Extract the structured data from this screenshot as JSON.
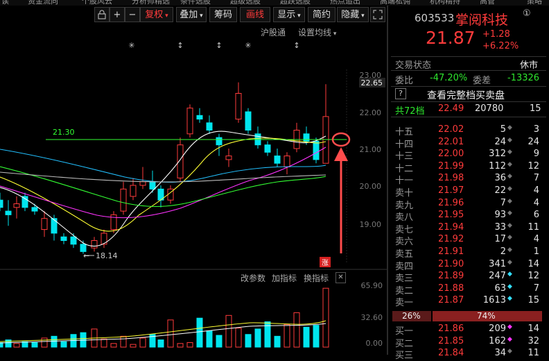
{
  "top_nav": [
    "读",
    "资金流向",
    "个股风云",
    "分析师精选",
    "条件选股",
    "超级选股",
    "超跌选股",
    "热点追出",
    "高端私佣",
    "机构精持",
    "高管",
    "策略"
  ],
  "toolbar": {
    "fuquan": "复权",
    "diejia": "叠加",
    "chouma": "筹码",
    "huaxian": "画线",
    "xianshi": "显示",
    "jianyue": "简约",
    "yincang": "隐藏",
    "plus": "+",
    "minus": "−",
    "fullscreen_icon": "expand-icon",
    "lock_icon": "lock-icon"
  },
  "chart_header": {
    "exchange": "沪股通",
    "ma_setting": "设置均线"
  },
  "indicator_header": {
    "change_params": "改参数",
    "add_indicator": "加指标",
    "switch_indicator": "换指标",
    "close": "✕"
  },
  "price_axis": [
    "23.00",
    "22.00",
    "21.00",
    "20.00",
    "19.00"
  ],
  "current_price_tag": "22.65",
  "hline_label": "21.30",
  "low_label": "18.14",
  "zhang_badge": "涨",
  "volume_axis": [
    "65.90",
    "32.60",
    "0.00"
  ],
  "stock": {
    "code": "603533",
    "name": "掌阅科技",
    "price": "21.87",
    "change": "+1.28",
    "change_pct": "+6.22%",
    "badge": "①"
  },
  "status": {
    "label": "交易状态",
    "value": "休市"
  },
  "weibi": {
    "label": "委比",
    "value": "-47.20%",
    "label2": "委差",
    "value2": "-13326"
  },
  "full_book": {
    "q": "?",
    "text": "查看完整档买卖盘"
  },
  "total_levels": {
    "label": "共72档",
    "price": "22.49",
    "vol": "20780",
    "count": "15"
  },
  "asks": [
    {
      "label": "十五",
      "price": "22.02",
      "vol": "5",
      "count": "3"
    },
    {
      "label": "十四",
      "price": "22.01",
      "vol": "24",
      "count": "24"
    },
    {
      "label": "十三",
      "price": "22.00",
      "vol": "312",
      "count": "9"
    },
    {
      "label": "十二",
      "price": "21.99",
      "vol": "112",
      "count": "12"
    },
    {
      "label": "十一",
      "price": "21.98",
      "vol": "36",
      "count": "7"
    },
    {
      "label": "卖十",
      "price": "21.97",
      "vol": "22",
      "count": "4"
    },
    {
      "label": "卖九",
      "price": "21.96",
      "vol": "7",
      "count": "4"
    },
    {
      "label": "卖八",
      "price": "21.95",
      "vol": "93",
      "count": "6"
    },
    {
      "label": "卖七",
      "price": "21.94",
      "vol": "33",
      "count": "11"
    },
    {
      "label": "卖六",
      "price": "21.92",
      "vol": "17",
      "count": "4"
    },
    {
      "label": "卖五",
      "price": "21.91",
      "vol": "2",
      "count": "1"
    },
    {
      "label": "卖四",
      "price": "21.90",
      "vol": "341",
      "count": "14"
    },
    {
      "label": "卖三",
      "price": "21.89",
      "vol": "247",
      "count": "12"
    },
    {
      "label": "卖二",
      "price": "21.88",
      "vol": "63",
      "count": "7"
    },
    {
      "label": "卖一",
      "price": "21.87",
      "vol": "1613",
      "count": "15"
    }
  ],
  "ratio": {
    "sell": "26%",
    "buy": "74%"
  },
  "bids": [
    {
      "label": "买一",
      "price": "21.86",
      "vol": "209",
      "count": "14"
    },
    {
      "label": "买二",
      "price": "21.85",
      "vol": "162",
      "count": "32"
    },
    {
      "label": "买三",
      "price": "21.84",
      "vol": "34",
      "count": "11"
    }
  ],
  "colors": {
    "up": "#ff3b3b",
    "down": "#00e5ee",
    "ma5": "#ffffff",
    "ma10": "#ffff33",
    "ma20": "#ff33ff",
    "ma30": "#33ff33",
    "ma60": "#22c0ff",
    "hline": "#33ff33",
    "arrow": "#ff4c4c"
  }
}
